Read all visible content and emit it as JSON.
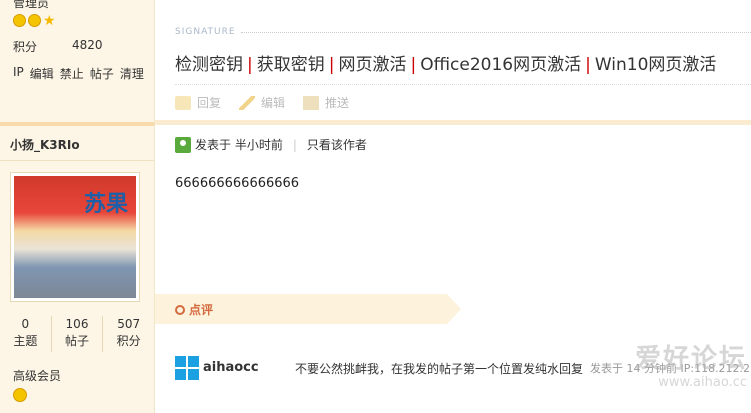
{
  "left_prev": {
    "rank": "管理员",
    "points_label": "积分",
    "points_value": "4820",
    "admin_links": [
      "IP",
      "编辑",
      "禁止",
      "帖子",
      "清理"
    ]
  },
  "user": {
    "name": "小扬_K3RIo",
    "avatar_text": "苏果",
    "stats": [
      {
        "value": "0",
        "label": "主题"
      },
      {
        "value": "106",
        "label": "帖子"
      },
      {
        "value": "507",
        "label": "积分"
      }
    ],
    "group": "高级会员"
  },
  "signature": {
    "label": "SIGNATURE",
    "links": [
      "检测密钥",
      "获取密钥",
      "网页激活",
      "Office2016网页激活",
      "Win10网页激活"
    ]
  },
  "actions": {
    "reply": "回复",
    "edit": "编辑",
    "push": "推送"
  },
  "post": {
    "posted": "发表于 半小时前",
    "only_author": "只看该作者",
    "content": "666666666666666"
  },
  "rating": {
    "label": "点评"
  },
  "comment": {
    "user": "aihaocc",
    "text": "不要公然挑衅我，在我发的帖子第一个位置发纯水回复",
    "meta": "发表于 14 分钟前 IP:118.212.2"
  },
  "watermark": {
    "line1": "爱好论坛",
    "line2": "www.aihao.cc"
  }
}
